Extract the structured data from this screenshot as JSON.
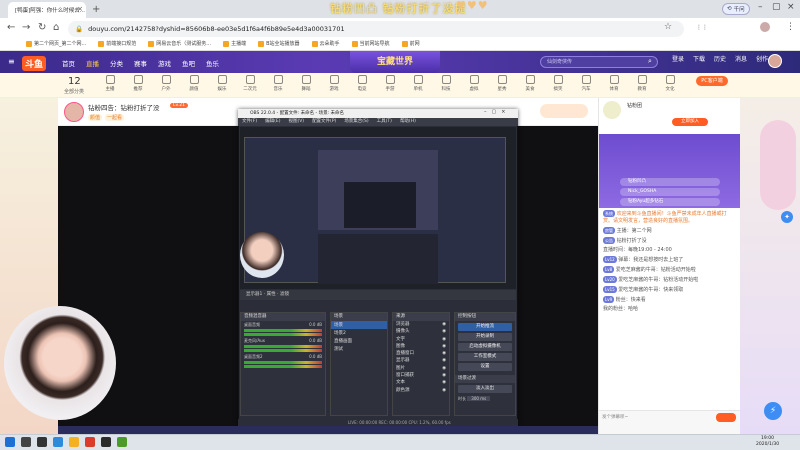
{
  "browser": {
    "tab_title": "[鸭蛋]阿强：你什么时候去...",
    "url": "douyu.com/2142758?dyshid=85606b8-ee03e5d1f6a4f6b89e5e4d3a00031701",
    "banner_text": "钻粉凹凸  钻粉打折了没提",
    "profile_label": "千问",
    "bookmarks": [
      "第二个网页_第二个网...",
      "前端接口规范",
      "网易云音乐（测试服务...",
      "主播端",
      "B站全站播放器",
      "云朵助手",
      "当前网站导航",
      "前网"
    ]
  },
  "douyu": {
    "logo": "斗鱼",
    "nav": [
      "首页",
      "直播",
      "分类",
      "赛事",
      "游戏",
      "鱼吧",
      "鱼乐"
    ],
    "nav_active": 1,
    "banner": "宝藏世界",
    "search_placeholder": "仙剑奇侠传",
    "header_icons": [
      "登录",
      "下载",
      "历史",
      "消息",
      "创作"
    ],
    "category_count": "12",
    "category_label": "全部分类",
    "categories": [
      "主播",
      "推荐",
      "户外",
      "颜值",
      "娱乐",
      "二次元",
      "音乐",
      "舞蹈",
      "游戏",
      "电竞",
      "手游",
      "单机",
      "科技",
      "虚拟",
      "星秀",
      "美食",
      "搞笑",
      "汽车",
      "体育",
      "教育",
      "文化"
    ],
    "pc_button": "PC客户端"
  },
  "room": {
    "title": "钻粉四告：钻粉打折了没",
    "level": "Lv.21",
    "tags": [
      "颜值",
      "一起看"
    ],
    "subtitle": "钻粉四告 · 颜值 · 一起看"
  },
  "obs": {
    "title": "OBS 22.0.4 - 配置文件: 未命名 - 场景: 未命名",
    "menu": [
      "文件(F)",
      "编辑(E)",
      "视图(V)",
      "配置文件(P)",
      "场景集合(S)",
      "工具(T)",
      "帮助(H)"
    ],
    "preview_bar": "显示器1 · 属性 · 滤镜",
    "dock_mixer": "音频混音器",
    "mixer": [
      {
        "name": "桌面音频",
        "level": "0.0 dB"
      },
      {
        "name": "麦克风/Aux",
        "level": "0.0 dB"
      },
      {
        "name": "桌面音频2",
        "level": "0.0 dB"
      }
    ],
    "dock_scenes": "场景",
    "scenes": [
      "场景",
      "场景2",
      "直播画面",
      "测试"
    ],
    "dock_sources": "来源",
    "sources": [
      "浏览器",
      "摄像头",
      "文字",
      "图像",
      "直播窗口",
      "显示器",
      "图片",
      "窗口捕获",
      "文本",
      "颜色源"
    ],
    "dock_controls": "控制按钮",
    "controls": [
      "开始推流",
      "开始录制",
      "启动虚拟摄像机",
      "工作室模式",
      "设置",
      "退出"
    ],
    "transition_label": "场景过渡",
    "transition": "淡入淡出",
    "duration_label": "时长",
    "duration": "300 ms",
    "status": "LIVE: 00:00:00   REC: 00:00:00   CPU: 1.2%, 60.00 fps"
  },
  "chat": {
    "fan_title": "钻粉团",
    "fan_button": "立即加入",
    "rank_users": [
      "钻粉凹凸",
      "Nick_GOSHA",
      "钻粉Ayu超多钻石"
    ],
    "messages": [
      {
        "badge": "系统",
        "text": "欢迎来到斗鱼直播间！斗鱼严禁未成年人直播或打赏。请文明发言，营造良好的直播氛围。"
      },
      {
        "badge": "房管",
        "text": "主播：第二个网"
      },
      {
        "badge": "公告",
        "text": "钻粉打折了没"
      },
      {
        "badge": "",
        "text": "直播时间：每晚19:00 - 24:00"
      },
      {
        "badge": "Lv12",
        "text": "弹幕：我还是想按时去上班了"
      },
      {
        "badge": "Lv8",
        "text": "爱吃芝麻酱的牛哥：钻粉活动开始啦"
      },
      {
        "badge": "Lv20",
        "text": "爱吃芝麻酱的牛哥：钻粉活动开始啦"
      },
      {
        "badge": "Lv15",
        "text": "爱吃芝麻酱的牛哥：快来领取"
      },
      {
        "badge": "Lv9",
        "text": "粉丝：快来看"
      },
      {
        "badge": "",
        "text": "我的粉丝：哈哈"
      }
    ],
    "input_placeholder": "发个弹幕呗~"
  },
  "taskbar": {
    "time": "19:00",
    "date": "2020/1/30"
  }
}
